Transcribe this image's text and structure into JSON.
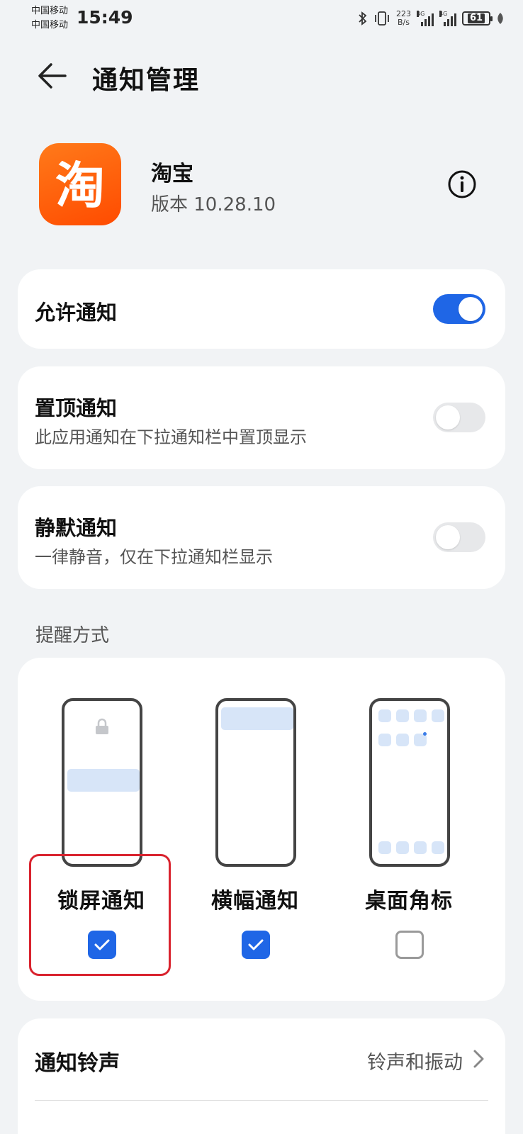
{
  "status_bar": {
    "carrier1": "中国移动",
    "carrier2": "中国移动",
    "time": "15:49",
    "net_speed_value": "223",
    "net_speed_unit": "B/s",
    "net_type1": "4G",
    "net_type2": "4G",
    "battery": "61"
  },
  "header": {
    "title": "通知管理",
    "back_icon": "arrow-left-icon"
  },
  "app": {
    "icon_glyph": "淘",
    "name": "淘宝",
    "version": "版本 10.28.10",
    "info_icon": "info-circle-icon"
  },
  "allow_notifications": {
    "label": "允许通知",
    "enabled": true
  },
  "pinned_notifications": {
    "label": "置顶通知",
    "description": "此应用通知在下拉通知栏中置顶显示",
    "enabled": false
  },
  "silent_notifications": {
    "label": "静默通知",
    "description": "一律静音，仅在下拉通知栏显示",
    "enabled": false
  },
  "reminder_section": {
    "label": "提醒方式",
    "options": [
      {
        "label": "锁屏通知",
        "checked": true,
        "illustration": "lockscreen-illustration"
      },
      {
        "label": "横幅通知",
        "checked": true,
        "illustration": "banner-illustration"
      },
      {
        "label": "桌面角标",
        "checked": false,
        "illustration": "badge-illustration"
      }
    ]
  },
  "ringtone": {
    "label": "通知铃声",
    "value": "铃声和振动"
  },
  "colors": {
    "accent": "#1f66e6",
    "app_orange": "#ff5a00",
    "highlight_red": "#d9232e",
    "background": "#f1f3f5"
  }
}
